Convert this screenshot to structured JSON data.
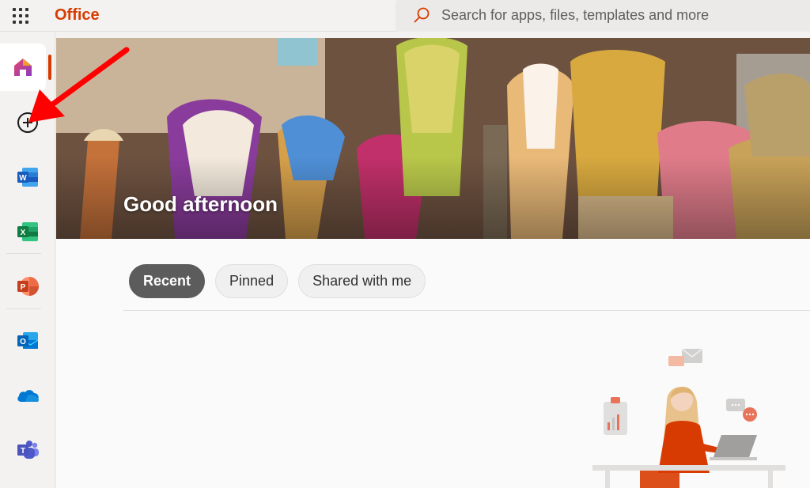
{
  "header": {
    "app_name": "Office",
    "search": {
      "placeholder": "Search for apps, files, templates and more"
    }
  },
  "rail": {
    "items": [
      {
        "id": "home",
        "icon": "home-icon",
        "active": true
      },
      {
        "id": "create",
        "icon": "add-icon"
      },
      {
        "id": "word",
        "icon": "word-icon",
        "letter": "W"
      },
      {
        "id": "excel",
        "icon": "excel-icon",
        "letter": "X"
      },
      {
        "id": "powerpoint",
        "icon": "powerpoint-icon",
        "letter": "P"
      },
      {
        "id": "outlook",
        "icon": "outlook-icon",
        "letter": "O"
      },
      {
        "id": "onedrive",
        "icon": "onedrive-icon"
      },
      {
        "id": "teams",
        "icon": "teams-icon",
        "letter": "T"
      }
    ]
  },
  "main": {
    "greeting": "Good afternoon",
    "tabs": [
      {
        "label": "Recent",
        "selected": true
      },
      {
        "label": "Pinned",
        "selected": false
      },
      {
        "label": "Shared with me",
        "selected": false
      }
    ]
  },
  "colors": {
    "brand": "#d83b01",
    "word": "#185abd",
    "excel": "#107c41",
    "powerpoint": "#c43e1c",
    "outlook": "#0078d4",
    "onedrive": "#0364b8",
    "teams": "#5059c9",
    "annotation": "#ff0000"
  }
}
